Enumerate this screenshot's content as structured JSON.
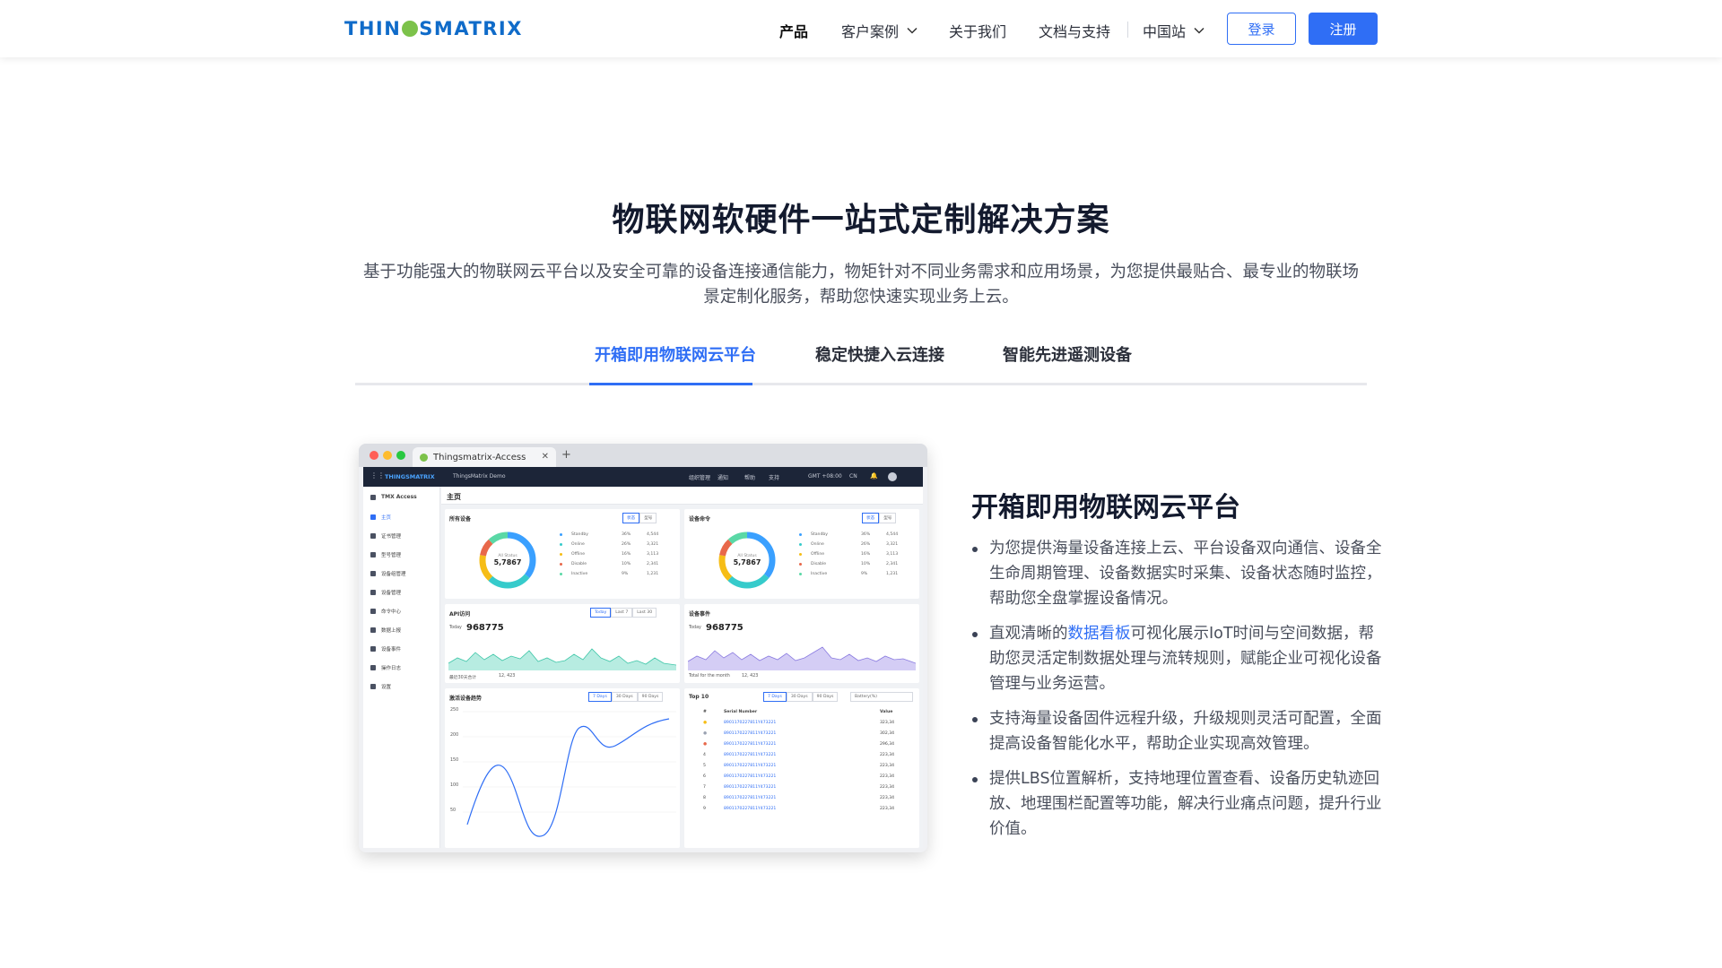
{
  "header": {
    "logo": {
      "left": "THIN",
      "middle": "G",
      "right": "SMATRIX"
    },
    "nav": [
      {
        "label": "产品"
      },
      {
        "label": "客户案例"
      },
      {
        "label": "关于我们"
      },
      {
        "label": "文档与支持"
      },
      {
        "label": "中国站"
      }
    ],
    "login_label": "登录",
    "register_label": "注册"
  },
  "hero": {
    "title": "物联网软硬件一站式定制解决方案",
    "subtitle": "基于功能强大的物联网云平台以及安全可靠的设备连接通信能力，物矩针对不同业务需求和应用场景，为您提供最贴合、最专业的物联场景定制化服务，帮助您快速实现业务上云。"
  },
  "tabs": [
    {
      "label": "开箱即用物联网云平台"
    },
    {
      "label": "稳定快捷入云连接"
    },
    {
      "label": "智能先进遥测设备"
    }
  ],
  "mockup": {
    "browser_tab": "Thingsmatrix-Access",
    "nav": {
      "logo": "THINGSMATRIX",
      "workspace": "ThingsMatrix Demo",
      "items": [
        "组织管理",
        "通知",
        "帮助",
        "支持",
        "GMT +08:00",
        "CN"
      ]
    },
    "sidebar": {
      "title": "TMX Access",
      "items": [
        "主页",
        "证书管理",
        "型号管理",
        "设备组管理",
        "设备管理",
        "命令中心",
        "数据上报",
        "设备事件",
        "操作日志",
        "设置"
      ]
    },
    "page_title": "主页",
    "cards": {
      "all_devices": "所有设备",
      "device_commands": "设备命令",
      "api_access": "API访问",
      "device_events": "设备事件",
      "active_trend": "激活设备趋势",
      "top10": "Top 10"
    },
    "segments": {
      "status": [
        "状态",
        "型号"
      ],
      "range1": [
        "Today",
        "Last 7",
        "Last 30"
      ],
      "range2": [
        "7 Days",
        "30 Days",
        "90 Days"
      ],
      "battery": "Battery(%)"
    },
    "donut": {
      "center_label": "All Status",
      "center_value": "5,7867",
      "legend": [
        {
          "name": "Standby",
          "pct": "36%",
          "value": "4,544",
          "color": "#3aa0ff"
        },
        {
          "name": "Online",
          "pct": "26%",
          "value": "3,321",
          "color": "#36cbcb"
        },
        {
          "name": "Offline",
          "pct": "16%",
          "value": "3,113",
          "color": "#f6bd16"
        },
        {
          "name": "Disable",
          "pct": "10%",
          "value": "2,341",
          "color": "#e8684a"
        },
        {
          "name": "Inactive",
          "pct": "9%",
          "value": "1,231",
          "color": "#5ad8a6"
        }
      ]
    },
    "api": {
      "today_label": "Today",
      "today_value": "968775",
      "footer_label": "最近30天合计",
      "footer_value": "12, 423"
    },
    "events": {
      "today_label": "Today",
      "today_value": "968775",
      "footer_label": "Total for the month",
      "footer_value": "12, 423"
    },
    "trend_axis": [
      "250",
      "200",
      "150",
      "100",
      "50"
    ],
    "top10": {
      "col_index": "#",
      "col_serial": "Serial Number",
      "col_value": "Value",
      "rows": [
        {
          "idx": "1",
          "sn": "8901170227811Y473221",
          "value": "323,34"
        },
        {
          "idx": "2",
          "sn": "8901170227811Y473221",
          "value": "302,34"
        },
        {
          "idx": "3",
          "sn": "8901170227811Y473221",
          "value": "296,34"
        },
        {
          "idx": "4",
          "sn": "8901170227811Y473221",
          "value": "223,34"
        },
        {
          "idx": "5",
          "sn": "8901170227811Y473221",
          "value": "223,34"
        },
        {
          "idx": "6",
          "sn": "8901170227811Y473221",
          "value": "223,34"
        },
        {
          "idx": "7",
          "sn": "8901170227811Y473221",
          "value": "223,34"
        },
        {
          "idx": "8",
          "sn": "8901170227811Y473221",
          "value": "223,34"
        },
        {
          "idx": "9",
          "sn": "8901170227811Y473221",
          "value": "223,34"
        }
      ]
    }
  },
  "detail": {
    "title": "开箱即用物联网云平台",
    "bullets": [
      {
        "text": "为您提供海量设备连接上云、平台设备双向通信、设备全生命周期管理、设备数据实时采集、设备状态随时监控，帮助您全盘掌握设备情况。"
      },
      {
        "pre": "直观清晰的",
        "link": "数据看板",
        "post": "可视化展示IoT时间与空间数据，帮助您灵活定制数据处理与流转规则，赋能企业可视化设备管理与业务运营。"
      },
      {
        "text": "支持海量设备固件远程升级，升级规则灵活可配置，全面提高设备智能化水平，帮助企业实现高效管理。"
      },
      {
        "text": "提供LBS位置解析，支持地理位置查看、设备历史轨迹回放、地理围栏配置等功能，解决行业痛点问题，提升行业价值。"
      }
    ]
  },
  "colors": {
    "accent": "#2f6ef5",
    "logo_blue": "#0f6bc9",
    "logo_green": "#7cc24a"
  }
}
